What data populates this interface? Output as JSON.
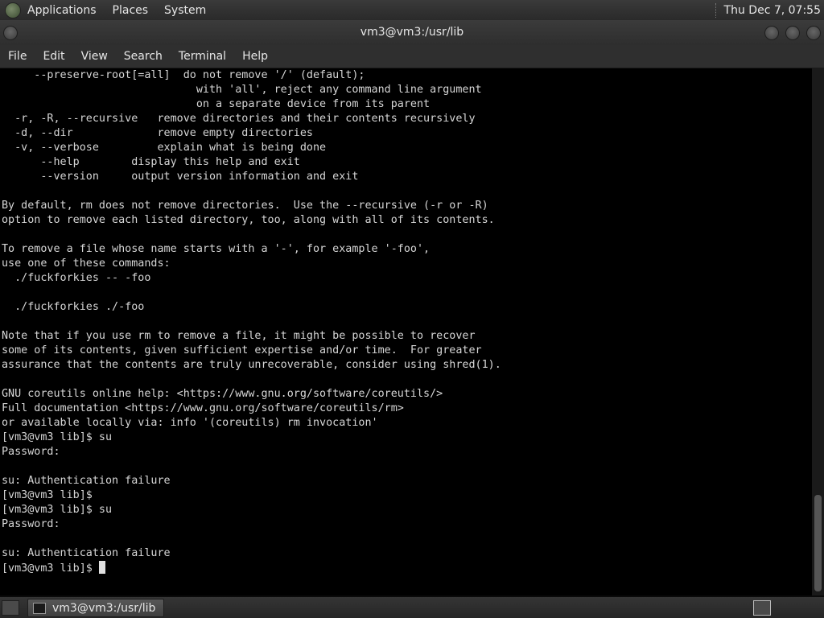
{
  "top_panel": {
    "menus": [
      "Applications",
      "Places",
      "System"
    ],
    "clock": "Thu Dec 7, 07:55"
  },
  "window": {
    "title": "vm3@vm3:/usr/lib"
  },
  "menubar": {
    "items": [
      "File",
      "Edit",
      "View",
      "Search",
      "Terminal",
      "Help"
    ]
  },
  "terminal": {
    "lines": [
      "     --preserve-root[=all]  do not remove '/' (default);",
      "                              with 'all', reject any command line argument",
      "                              on a separate device from its parent",
      "  -r, -R, --recursive   remove directories and their contents recursively",
      "  -d, --dir             remove empty directories",
      "  -v, --verbose         explain what is being done",
      "      --help        display this help and exit",
      "      --version     output version information and exit",
      "",
      "By default, rm does not remove directories.  Use the --recursive (-r or -R)",
      "option to remove each listed directory, too, along with all of its contents.",
      "",
      "To remove a file whose name starts with a '-', for example '-foo',",
      "use one of these commands:",
      "  ./fuckforkies -- -foo",
      "",
      "  ./fuckforkies ./-foo",
      "",
      "Note that if you use rm to remove a file, it might be possible to recover",
      "some of its contents, given sufficient expertise and/or time.  For greater",
      "assurance that the contents are truly unrecoverable, consider using shred(1).",
      "",
      "GNU coreutils online help: <https://www.gnu.org/software/coreutils/>",
      "Full documentation <https://www.gnu.org/software/coreutils/rm>",
      "or available locally via: info '(coreutils) rm invocation'",
      "[vm3@vm3 lib]$ su",
      "Password: ",
      "",
      "su: Authentication failure",
      "[vm3@vm3 lib]$ ",
      "[vm3@vm3 lib]$ su",
      "Password: ",
      "",
      "su: Authentication failure",
      "[vm3@vm3 lib]$ "
    ],
    "prompt": "[vm3@vm3 lib]$ "
  },
  "bottom_panel": {
    "task_label": "vm3@vm3:/usr/lib"
  },
  "icons": {
    "app_logo": "gnome-foot-icon",
    "show_desktop": "show-desktop-icon",
    "terminal_task": "terminal-icon",
    "workspace": "workspace-switcher-icon"
  }
}
